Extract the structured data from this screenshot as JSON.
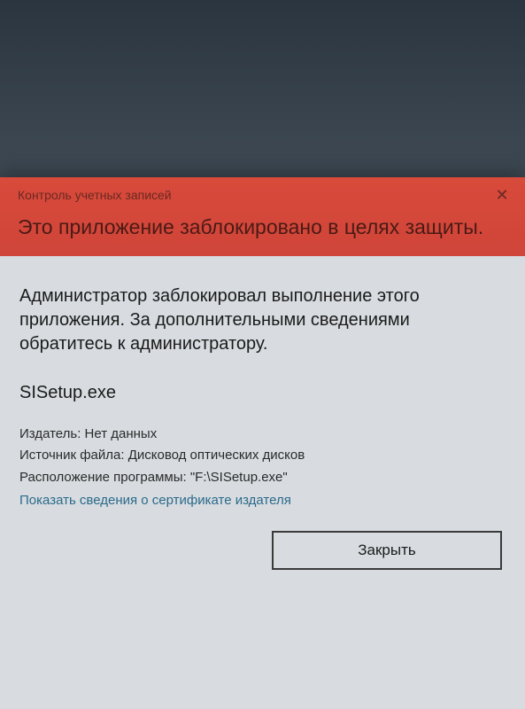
{
  "dialog": {
    "caption": "Контроль учетных записей",
    "title": "Это приложение заблокировано в целях защиты.",
    "close_icon": "✕"
  },
  "body": {
    "message": "Администратор заблокировал выполнение этого приложения. За дополнительными сведениями обратитесь к администратору.",
    "filename": "SISetup.exe",
    "publisher_label": "Издатель:",
    "publisher_value": "Нет данных",
    "source_label": "Источник файла:",
    "source_value": "Дисковод оптических дисков",
    "location_label": "Расположение программы:",
    "location_value": "\"F:\\SISetup.exe\"",
    "cert_link": "Показать сведения о сертификате издателя",
    "close_button": "Закрыть"
  }
}
